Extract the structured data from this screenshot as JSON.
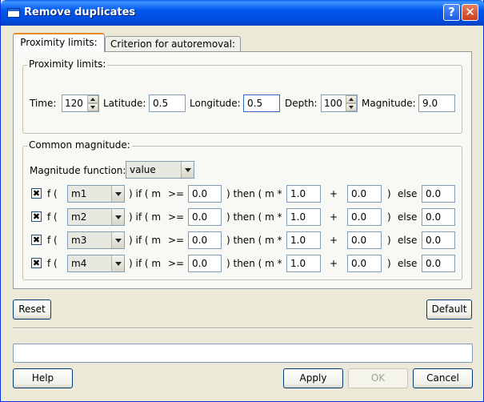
{
  "window": {
    "title": "Remove duplicates"
  },
  "tabs": [
    {
      "label": "Proximity limits:"
    },
    {
      "label": "Criterion for autoremoval:"
    }
  ],
  "proximity": {
    "group_label": "Proximity limits:",
    "time_label": "Time:",
    "time_value": "120",
    "latitude_label": "Latitude:",
    "latitude_value": "0.5",
    "longitude_label": "Longitude:",
    "longitude_value": "0.5",
    "depth_label": "Depth:",
    "depth_value": "100",
    "magnitude_label": "Magnitude:",
    "magnitude_value": "9.0"
  },
  "common": {
    "group_label": "Common magnitude:",
    "function_label": "Magnitude function:",
    "function_value": "value",
    "rows": [
      {
        "checked": "✖",
        "f": "f (",
        "mag": "m1",
        "if": ") if ( m",
        "op": ">=",
        "threshold": "0.0",
        "then": ") then ( m *",
        "mult": "1.0",
        "plus": "+",
        "add": "0.0",
        "close": ")",
        "else": "else",
        "else_value": "0.0"
      },
      {
        "checked": "✖",
        "f": "f (",
        "mag": "m2",
        "if": ") if ( m",
        "op": ">=",
        "threshold": "0.0",
        "then": ") then ( m *",
        "mult": "1.0",
        "plus": "+",
        "add": "0.0",
        "close": ")",
        "else": "else",
        "else_value": "0.0"
      },
      {
        "checked": "✖",
        "f": "f (",
        "mag": "m3",
        "if": ") if ( m",
        "op": ">=",
        "threshold": "0.0",
        "then": ") then ( m *",
        "mult": "1.0",
        "plus": "+",
        "add": "0.0",
        "close": ")",
        "else": "else",
        "else_value": "0.0"
      },
      {
        "checked": "✖",
        "f": "f (",
        "mag": "m4",
        "if": ") if ( m",
        "op": ">=",
        "threshold": "0.0",
        "then": ") then ( m *",
        "mult": "1.0",
        "plus": "+",
        "add": "0.0",
        "close": ")",
        "else": "else",
        "else_value": "0.0"
      }
    ]
  },
  "buttons": {
    "reset": "Reset",
    "default": "Default",
    "help": "Help",
    "apply": "Apply",
    "ok": "OK",
    "cancel": "Cancel"
  },
  "icons": {
    "help": "?",
    "close": "✕"
  }
}
